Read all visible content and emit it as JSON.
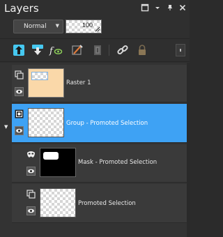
{
  "panel": {
    "title": "Layers"
  },
  "blend": {
    "mode": "Normal",
    "opacity": "100"
  },
  "toolbar": {
    "tools": [
      "new-raster-layer-icon",
      "new-mask-layer-icon",
      "effects-fx-icon",
      "link-brush-icon",
      "delete-layer-icon",
      "link-icon",
      "lock-icon"
    ]
  },
  "layers": [
    {
      "name": "Raster 1",
      "selected": false,
      "thumb": "peach"
    },
    {
      "name": "Group - Promoted Selection",
      "selected": true,
      "thumb": "checker"
    },
    {
      "name": "Mask - Promoted Selection",
      "selected": false,
      "thumb": "mask"
    },
    {
      "name": "Promoted Selection",
      "selected": false,
      "thumb": "checker"
    }
  ],
  "colors": {
    "selected": "#3ea2f4",
    "raster_thumb": "#fad8a9",
    "accent_cyan": "#46c8f0"
  }
}
